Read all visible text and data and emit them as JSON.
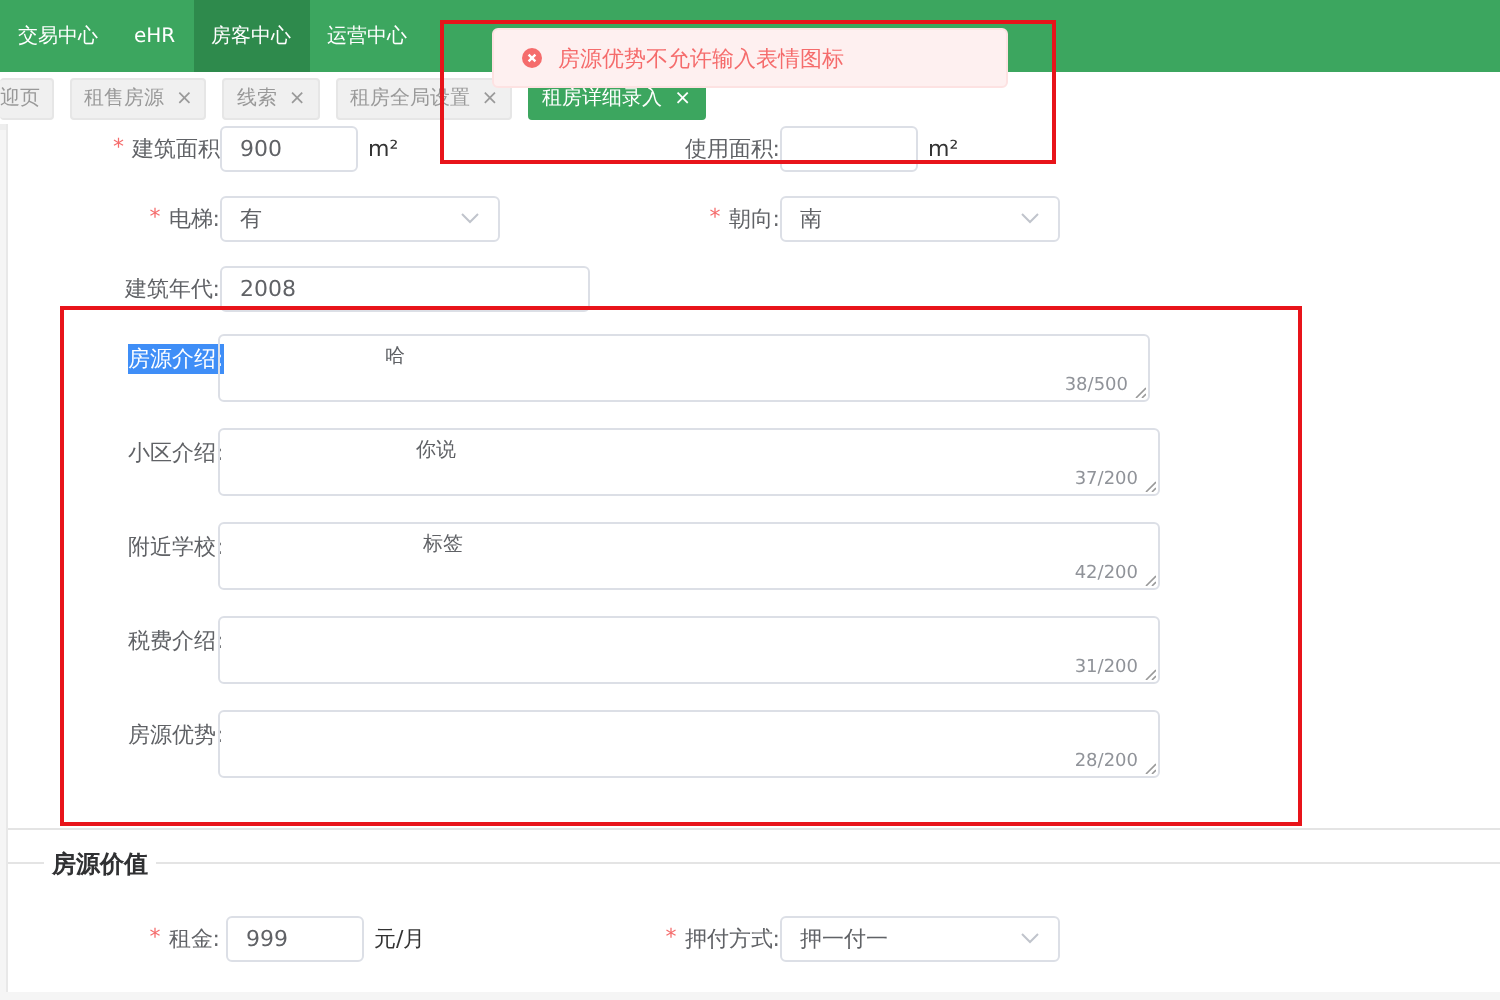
{
  "top_nav": {
    "items": [
      {
        "label": "交易中心",
        "selected": false
      },
      {
        "label": "eHR",
        "selected": false
      },
      {
        "label": "房客中心",
        "selected": true
      },
      {
        "label": "运营中心",
        "selected": false
      }
    ]
  },
  "tags": [
    {
      "label": "迎页",
      "selected": false
    },
    {
      "label": "租售房源",
      "close": "×",
      "selected": false
    },
    {
      "label": "线索",
      "close": "×",
      "selected": false
    },
    {
      "label": "租房全局设置",
      "close": "×",
      "selected": false
    },
    {
      "label": "租房详细录入",
      "close": "×",
      "selected": true
    }
  ],
  "toast": {
    "kind": "error",
    "message": "房源优势不允许输入表情图标"
  },
  "basic_rows": [
    {
      "fields": [
        {
          "kind": "input",
          "label": "建筑面积",
          "required_mark": "*",
          "value": "900",
          "unit": "m²"
        },
        {
          "kind": "input",
          "label": "使用面积:",
          "unit": "m²"
        }
      ]
    },
    {
      "fields": [
        {
          "kind": "select",
          "label": "电梯:",
          "required_mark": "*",
          "value": "有"
        },
        {
          "kind": "select",
          "label": "朝向:",
          "required_mark": "*",
          "value": "南"
        }
      ]
    },
    {
      "fields": [
        {
          "kind": "wide_input",
          "label": "建筑年代:",
          "value": "2008"
        }
      ]
    }
  ],
  "descriptions": [
    {
      "label": "房源介绍:",
      "highlighted": true,
      "value": "                        哈",
      "count": "38/500"
    },
    {
      "label": "小区介绍:",
      "highlighted": false,
      "value": "                             你说",
      "count": "37/200"
    },
    {
      "label": "附近学校:",
      "highlighted": false,
      "value": "                              标签",
      "count": "42/200"
    },
    {
      "label": "税费介绍:",
      "highlighted": false,
      "count": "31/200"
    },
    {
      "label": "房源优势:",
      "highlighted": false,
      "count": "28/200"
    }
  ],
  "value_section": {
    "title": "房源价值",
    "fields": [
      {
        "kind": "input",
        "label": "租金:",
        "required_mark": "*",
        "value": "999",
        "unit": "元/月"
      },
      {
        "kind": "select",
        "label": "押付方式:",
        "required_mark": "*",
        "value": "押一付一"
      }
    ]
  },
  "annotations": [
    {
      "kind": "box"
    },
    {
      "kind": "box"
    }
  ]
}
